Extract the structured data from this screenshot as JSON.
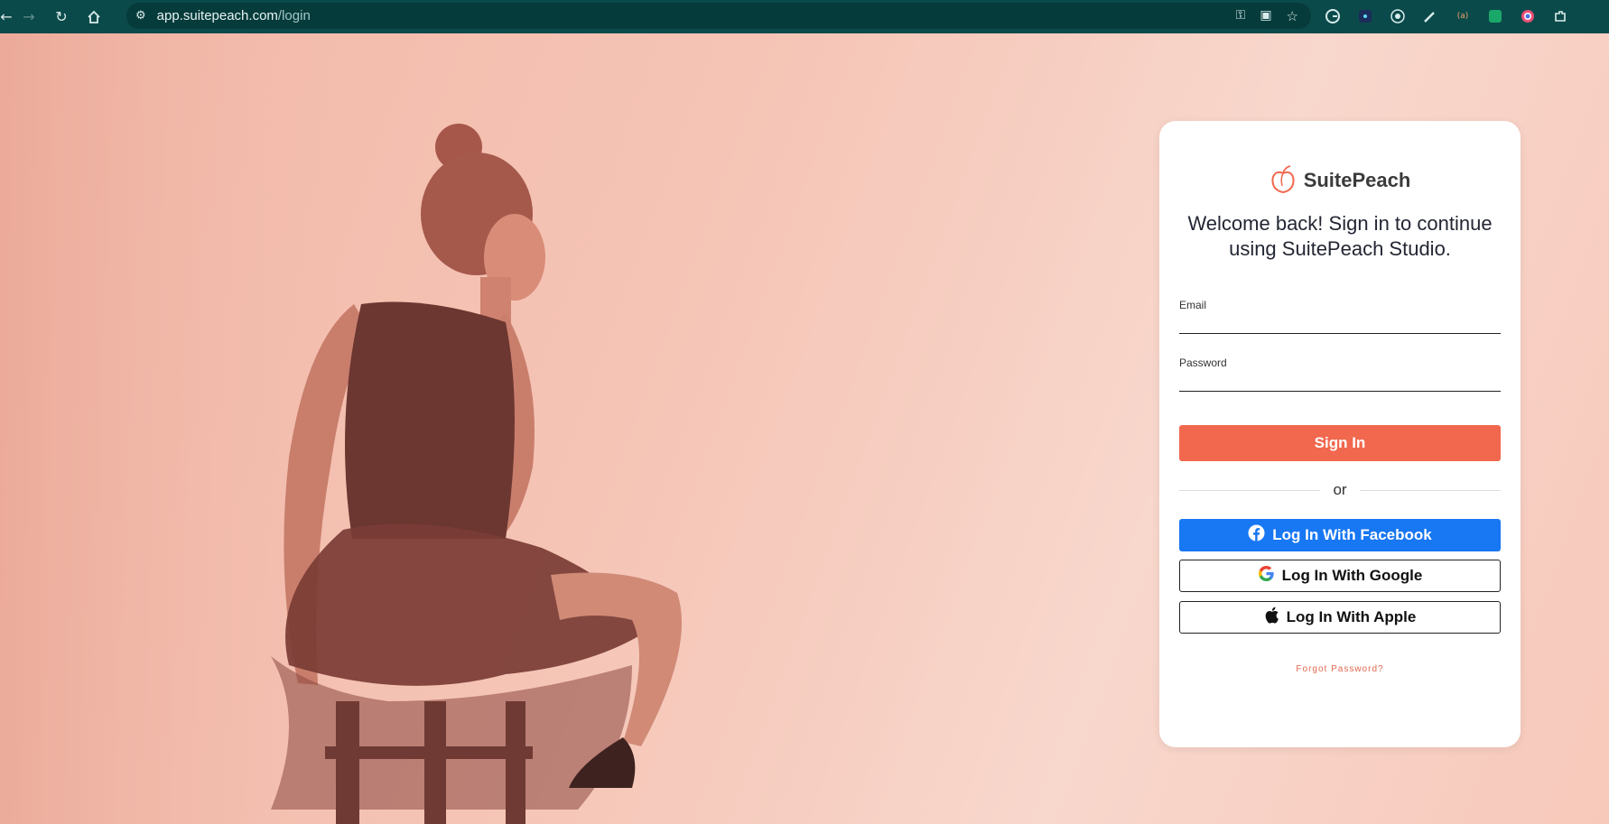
{
  "browser": {
    "url_host": "app.suitepeach.com",
    "url_path": "/login",
    "icons": [
      "back-icon",
      "forward-icon",
      "reload-icon",
      "home-icon",
      "site-info-icon",
      "password-key-icon",
      "install-app-icon",
      "bookmark-star-icon"
    ],
    "extensions": [
      "grammarly-icon",
      "react-devtools-icon",
      "extension-circle-icon",
      "color-picker-icon",
      "extension-ai-icon",
      "extension-green-icon",
      "extension-chrome-icon",
      "extensions-puzzle-icon"
    ]
  },
  "login": {
    "brand_name": "SuitePeach",
    "brand_color": "#f1684e",
    "welcome_text": "Welcome back! Sign in to continue using SuitePeach Studio.",
    "email_label": "Email",
    "email_value": "",
    "password_label": "Password",
    "password_value": "",
    "signin_label": "Sign In",
    "divider_text": "or",
    "facebook_label": "Log In With Facebook",
    "facebook_color": "#1877f2",
    "google_label": "Log In With Google",
    "apple_label": "Log In With Apple",
    "forgot_label": "Forgot Password?"
  }
}
